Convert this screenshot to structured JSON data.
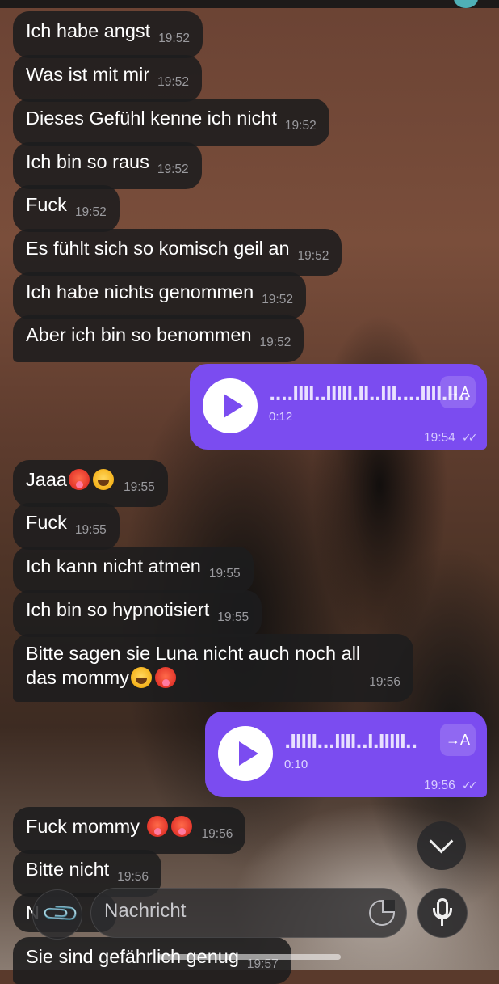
{
  "chat": {
    "messages": [
      {
        "text": "Ich habe angst",
        "time": "19:52"
      },
      {
        "text": "Was ist mit mir",
        "time": "19:52"
      },
      {
        "text": "Dieses Gefühl kenne ich nicht",
        "time": "19:52"
      },
      {
        "text": "Ich bin so raus",
        "time": "19:52"
      },
      {
        "text": "Fuck",
        "time": "19:52"
      },
      {
        "text": "Es fühlt sich so komisch geil an",
        "time": "19:52"
      },
      {
        "text": "Ich habe nichts genommen",
        "time": "19:52"
      },
      {
        "text": "Aber ich bin so benommen",
        "time": "19:52"
      },
      {
        "text": "Jaaa",
        "time": "19:55"
      },
      {
        "text": "Fuck",
        "time": "19:55"
      },
      {
        "text": "Ich kann nicht atmen",
        "time": "19:55"
      },
      {
        "text": "Ich bin so hypnotisiert",
        "time": "19:55"
      },
      {
        "text_line1": "Bitte sagen sie Luna nicht auch noch all",
        "text_line2": "das mommy",
        "time": "19:56"
      },
      {
        "text": "Fuck mommy",
        "time": "19:56"
      },
      {
        "text": "Bitte nicht",
        "time": "19:56"
      },
      {
        "text": "N",
        "text_tail": "n",
        "time": ""
      },
      {
        "text": "Sie sind gefährlich genug",
        "time": "19:57"
      }
    ],
    "voice_messages": [
      {
        "waveform": "....llll..lllll.ll..lll....llll.ll..",
        "duration": "0:12",
        "time": "19:54",
        "transcribe_label": "→A",
        "check": "✓✓"
      },
      {
        "waveform": ".lllll...llll..l.lllll..",
        "duration": "0:10",
        "time": "19:56",
        "transcribe_label": "→A",
        "check": "✓✓"
      }
    ]
  },
  "input": {
    "placeholder": "Nachricht"
  },
  "icons": {
    "attach": "paperclip-icon",
    "sticker": "sticker-icon",
    "mic": "microphone-icon",
    "scroll": "chevron-down-icon",
    "play": "play-icon",
    "emoji_hot": "hot-face-emoji",
    "emoji_cry": "loudly-crying-emoji"
  },
  "colors": {
    "outgoing_bubble": "#7b4cf0",
    "incoming_bubble": "#1c1c1e",
    "timestamp": "#9a9a9e"
  }
}
